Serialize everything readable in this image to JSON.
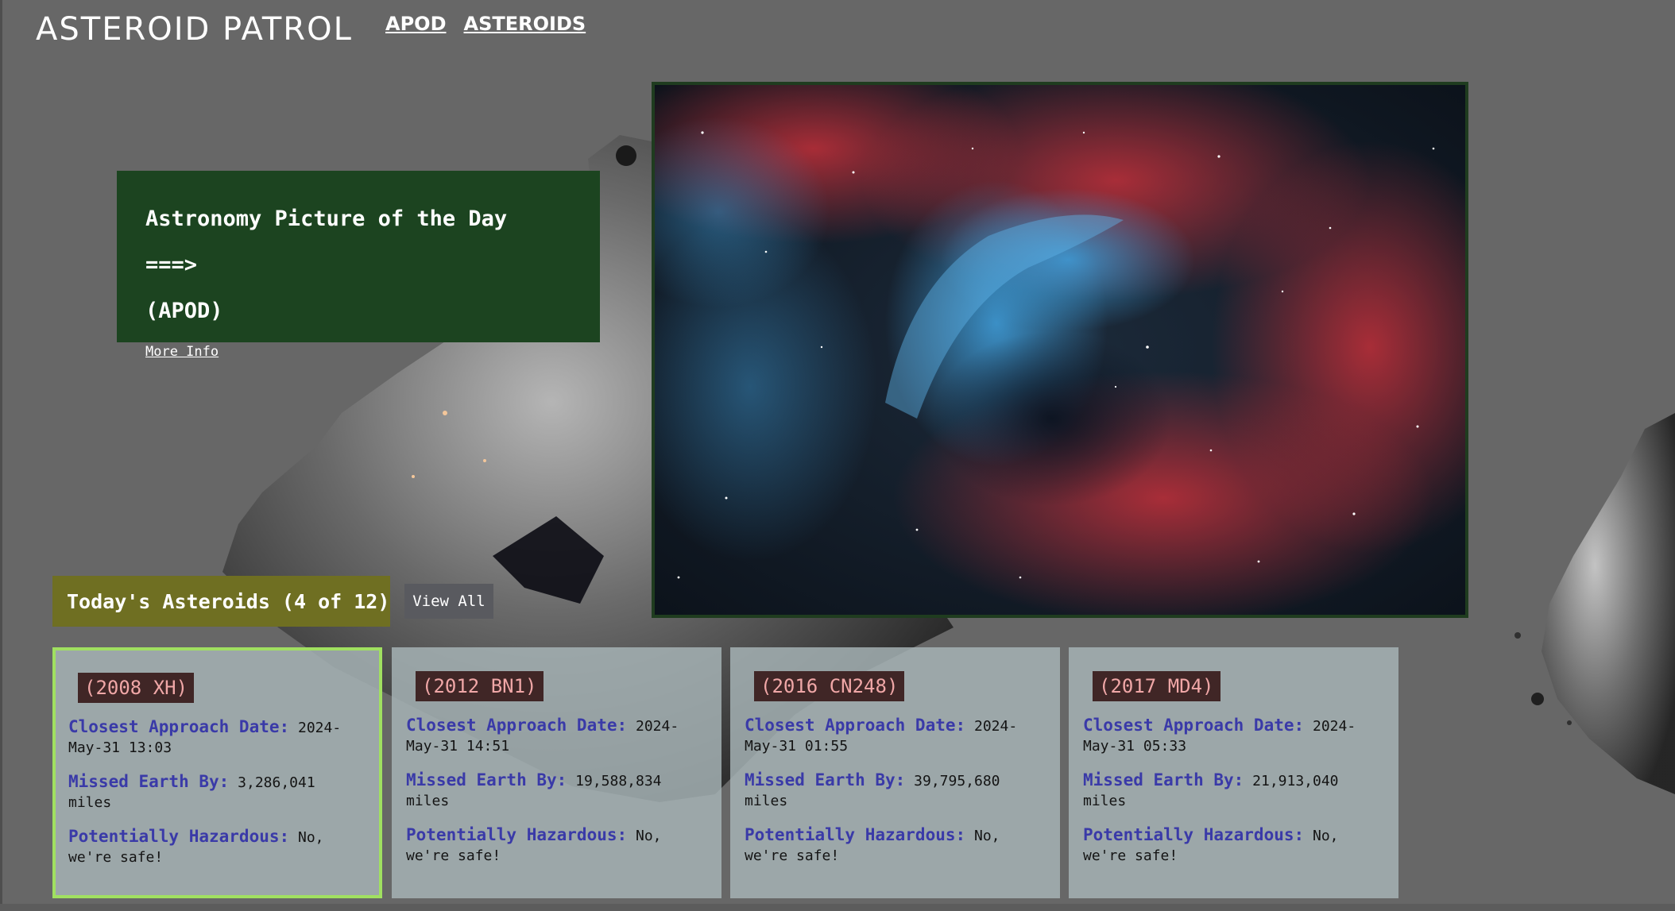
{
  "header": {
    "title": "ASTEROID PATROL",
    "nav": [
      "APOD",
      "ASTEROIDS"
    ]
  },
  "apod": {
    "title_line1": "Astronomy Picture of the Day ===>",
    "title_line2": "(APOD)",
    "more_info": "More Info"
  },
  "today": {
    "label": "Today's Asteroids (4 of 12)",
    "view_all": "View All"
  },
  "labels": {
    "approach": "Closest Approach Date:",
    "missed": "Missed Earth By:",
    "hazard": "Potentially Hazardous:"
  },
  "cards": [
    {
      "name": "(2008 XH)",
      "date": "2024-May-31 13:03",
      "distance": "3,286,041 miles",
      "hazard": "No, we're safe!"
    },
    {
      "name": "(2012 BN1)",
      "date": "2024-May-31 14:51",
      "distance": "19,588,834 miles",
      "hazard": "No, we're safe!"
    },
    {
      "name": "(2016 CN248)",
      "date": "2024-May-31 01:55",
      "distance": "39,795,680 miles",
      "hazard": "No, we're safe!"
    },
    {
      "name": "(2017 MD4)",
      "date": "2024-May-31 05:33",
      "distance": "21,913,040 miles",
      "hazard": "No, we're safe!"
    }
  ],
  "colors": {
    "background": "#676767",
    "apod_panel": "#1c4420",
    "today_box": "#6f6f22",
    "card_label": "#3a3aa8",
    "card_name_bg": "#402626",
    "card_name_text": "#f0a7a7",
    "selected_border": "#a0e060"
  }
}
